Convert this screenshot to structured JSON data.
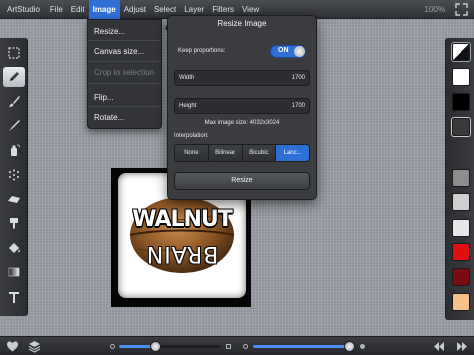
{
  "menubar": {
    "app_name": "ArtStudio",
    "items": [
      "File",
      "Edit",
      "Image",
      "Adjust",
      "Select",
      "Layer",
      "Filters",
      "View"
    ],
    "active_item": "Image",
    "zoom": "100%"
  },
  "image_menu": {
    "items": [
      {
        "label": "Resize...",
        "enabled": true
      },
      {
        "label": "Canvas size...",
        "enabled": true
      },
      {
        "label": "Crop to selection",
        "enabled": false
      },
      {
        "label": "Flip...",
        "enabled": true
      },
      {
        "label": "Rotate...",
        "enabled": true
      }
    ]
  },
  "resize_dialog": {
    "title": "Resize Image",
    "keep_proportions_label": "Keep proportions:",
    "keep_proportions_state": "ON",
    "width_label": "Width",
    "width_value": "1700",
    "height_label": "Height",
    "height_value": "1700",
    "max_size_text": "Max image size: 4032x3024",
    "interpolation_label": "Interpolation:",
    "interpolation_options": [
      "None",
      "Bilinear",
      "Bicubic",
      "Lanc..."
    ],
    "interpolation_selected": "Lanc...",
    "resize_button": "Resize"
  },
  "document": {
    "text_top": "WALNUT",
    "text_bottom": "BRAIN"
  },
  "color_swatches": [
    {
      "name": "current-color",
      "color": "#ffffff"
    },
    {
      "name": "black",
      "color": "#000000"
    },
    {
      "name": "dark-gray",
      "color": "#3a3a3a"
    },
    {
      "name": "gray",
      "color": "#8a8a8a"
    },
    {
      "name": "light-gray",
      "color": "#cfcfcf"
    },
    {
      "name": "red",
      "color": "#e01010"
    },
    {
      "name": "dark-red",
      "color": "#7a0a14"
    },
    {
      "name": "peach",
      "color": "#f5c08a"
    }
  ],
  "tools": [
    "marquee-tool",
    "pencil-tool",
    "brush-tool",
    "smudge-tool",
    "spray-tool",
    "blur-tool",
    "eraser-tool",
    "clone-tool",
    "fill-tool",
    "gradient-tool",
    "text-tool"
  ],
  "selected_tool": "pencil-tool",
  "bottombar": {
    "brush_size_fraction": 0.36,
    "opacity_fraction": 0.95
  },
  "colors": {
    "accent": "#2f6fd6",
    "panel": "#3a3c40",
    "canvas_bg": "#9a9ea6"
  }
}
